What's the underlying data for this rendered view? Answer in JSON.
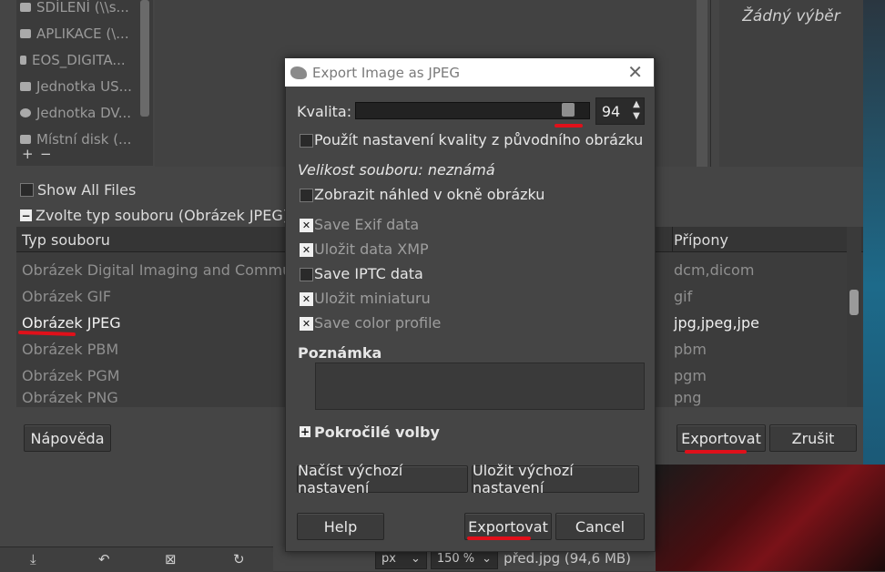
{
  "background": {
    "places": [
      "SDÍLENÍ (\\\\s...",
      "APLIKACE (\\...",
      "EOS_DIGITA...",
      "Jednotka US...",
      "Jednotka DV...",
      "Místní disk (..."
    ],
    "places_add": "+",
    "places_remove": "−",
    "preview_none": "Žádný výběr",
    "show_all_files": "Show All Files",
    "file_type_toggle": "Zvolte typ souboru (Obrázek JPEG)",
    "file_type_header": "Typ souboru",
    "extensions_header": "Přípony",
    "file_types": [
      {
        "name": "Obrázek Digital Imaging and Communications",
        "ext": "dcm,dicom",
        "selected": false
      },
      {
        "name": "Obrázek GIF",
        "ext": "gif",
        "selected": false
      },
      {
        "name": "Obrázek JPEG",
        "ext": "jpg,jpeg,jpe",
        "selected": true
      },
      {
        "name": "Obrázek PBM",
        "ext": "pbm",
        "selected": false
      },
      {
        "name": "Obrázek PGM",
        "ext": "pgm",
        "selected": false
      },
      {
        "name": "Obrázek PNG",
        "ext": "png",
        "selected": false
      }
    ],
    "help_button": "Nápověda",
    "export_button": "Exportovat",
    "cancel_button": "Zrušit",
    "zoom_unit": "px",
    "zoom_level": "150 %",
    "status_text": "před.jpg (94,6 MB)"
  },
  "dialog": {
    "title": "Export Image as JPEG",
    "quality_label": "Kvalita:",
    "quality_value": "94",
    "quality_fraction": 0.94,
    "use_original_quality": "Použít nastavení kvality z původního obrázku",
    "file_size": "Velikost souboru: neznámá",
    "show_preview": "Zobrazit náhled v okně obrázku",
    "options": [
      {
        "label": "Save Exif data",
        "checked": true
      },
      {
        "label": "Uložit data XMP",
        "checked": true
      },
      {
        "label": "Save IPTC data",
        "checked": false
      },
      {
        "label": "Uložit miniaturu",
        "checked": true
      },
      {
        "label": "Save color profile",
        "checked": true
      }
    ],
    "comment_label": "Poznámka",
    "advanced_label": "Pokročilé volby",
    "load_defaults": "Načíst výchozí nastavení",
    "save_defaults": "Uložit výchozí nastavení",
    "help": "Help",
    "export": "Exportovat",
    "cancel": "Cancel"
  }
}
